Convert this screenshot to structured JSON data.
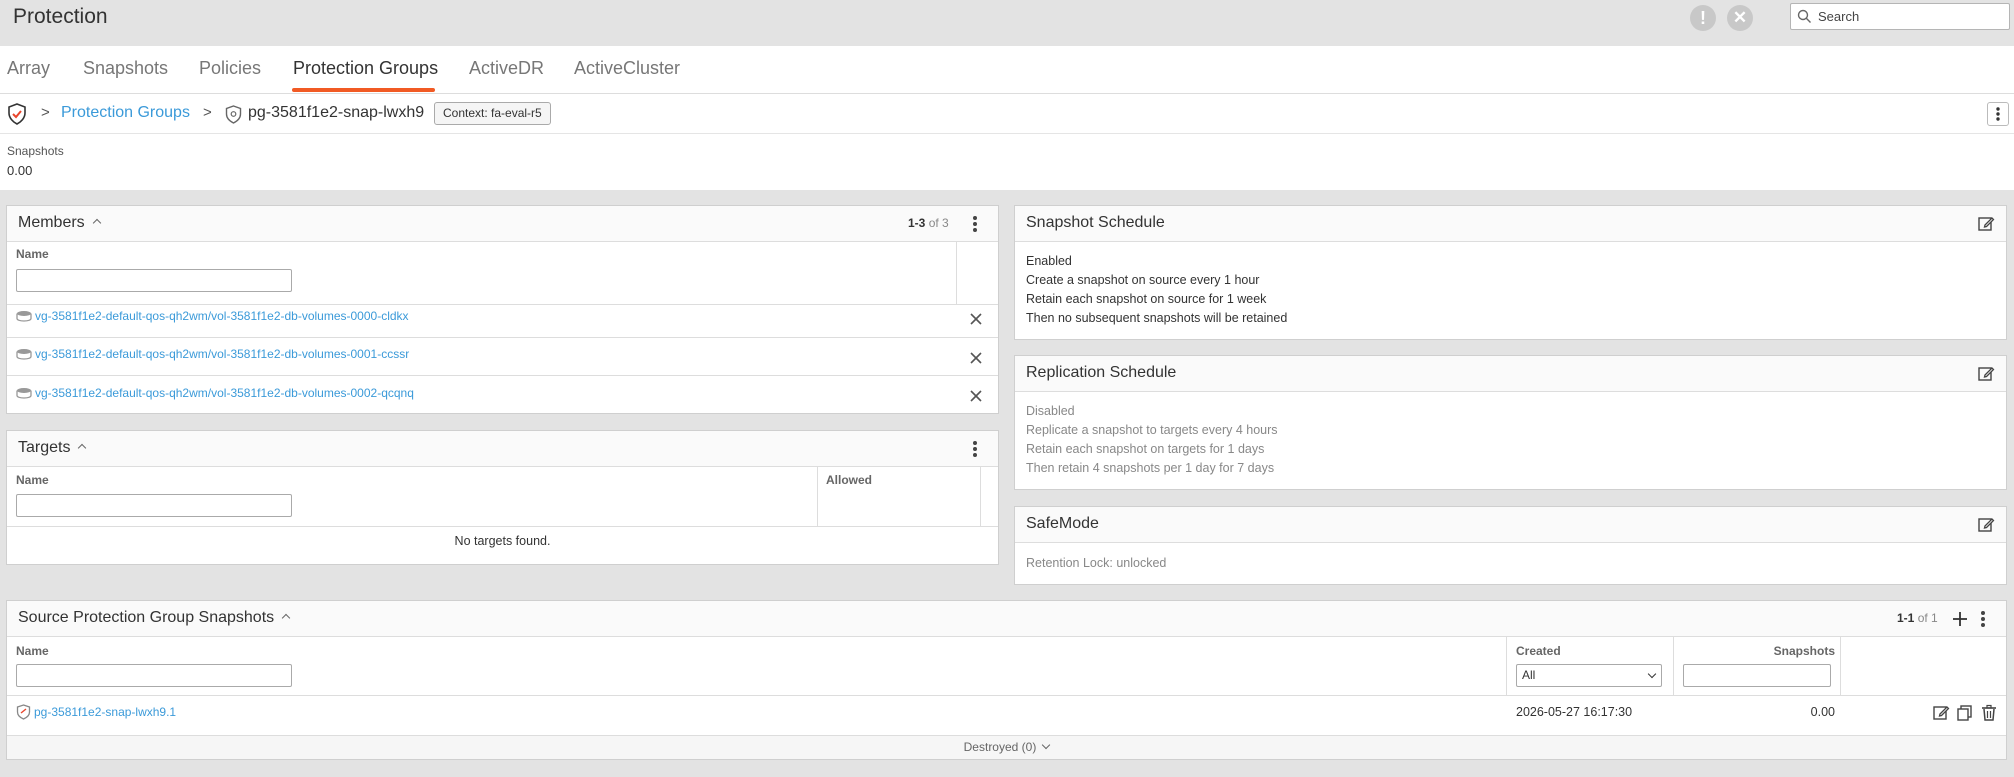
{
  "app": {
    "title": "Protection",
    "search_placeholder": "Search"
  },
  "nav": {
    "tabs": [
      {
        "label": "Array"
      },
      {
        "label": "Snapshots"
      },
      {
        "label": "Policies"
      },
      {
        "label": "Protection Groups",
        "active": true
      },
      {
        "label": "ActiveDR"
      },
      {
        "label": "ActiveCluster"
      }
    ]
  },
  "breadcrumb": {
    "separator": ">",
    "parent": "Protection Groups",
    "current": "pg-3581f1e2-snap-lwxh9",
    "context": "Context: fa-eval-r5"
  },
  "stats": {
    "label": "Snapshots",
    "value": "0.00"
  },
  "members": {
    "title": "Members",
    "range": "1-3",
    "total": "of 3",
    "column_name": "Name",
    "rows": [
      {
        "name": "vg-3581f1e2-default-qos-qh2wm/vol-3581f1e2-db-volumes-0000-cldkx"
      },
      {
        "name": "vg-3581f1e2-default-qos-qh2wm/vol-3581f1e2-db-volumes-0001-ccssr"
      },
      {
        "name": "vg-3581f1e2-default-qos-qh2wm/vol-3581f1e2-db-volumes-0002-qcqnq"
      }
    ]
  },
  "targets": {
    "title": "Targets",
    "column_name": "Name",
    "column_allowed": "Allowed",
    "empty_text": "No targets found."
  },
  "snapshot_schedule": {
    "title": "Snapshot Schedule",
    "lines": [
      "Enabled",
      "Create a snapshot on source every 1 hour",
      "Retain each snapshot on source for 1 week",
      "Then no subsequent snapshots will be retained"
    ]
  },
  "replication_schedule": {
    "title": "Replication Schedule",
    "lines": [
      "Disabled",
      "Replicate a snapshot to targets every 4 hours",
      "Retain each snapshot on targets for 1 days",
      "Then retain 4 snapshots per 1 day for 7 days"
    ]
  },
  "safemode": {
    "title": "SafeMode",
    "text": "Retention Lock: unlocked"
  },
  "source_snapshots": {
    "title": "Source Protection Group Snapshots",
    "range": "1-1",
    "total": "of 1",
    "column_name": "Name",
    "column_created": "Created",
    "column_snapshots": "Snapshots",
    "created_filter": "All",
    "rows": [
      {
        "name": "pg-3581f1e2-snap-lwxh9.1",
        "created": "2026-05-27 16:17:30",
        "snapshots": "0.00"
      }
    ],
    "destroyed_toggle": "Destroyed (0)"
  },
  "colors": {
    "accent": "#f15a24",
    "link": "#3b9ad9",
    "background": "#e3e3e3"
  },
  "icons": [
    "alert-icon",
    "close-circle-icon",
    "search-icon",
    "shield-check-icon",
    "shield-icon",
    "volume-icon",
    "kebab-icon",
    "edit-icon",
    "close-icon",
    "plus-icon",
    "copy-icon",
    "trash-icon"
  ]
}
